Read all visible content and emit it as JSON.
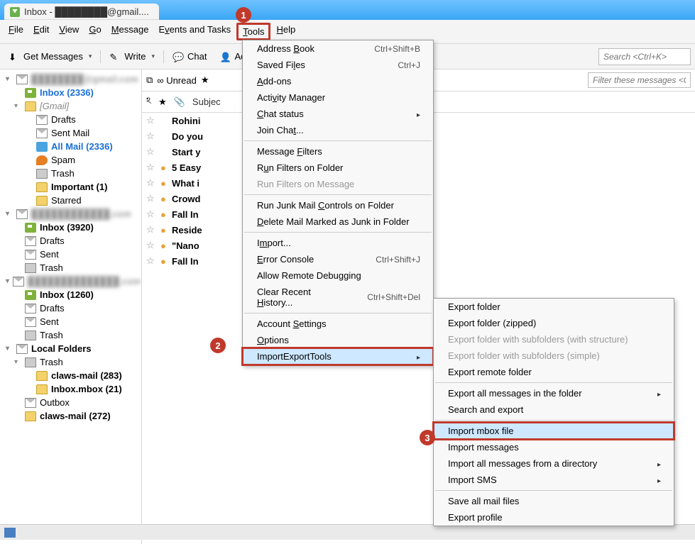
{
  "tab": {
    "title": "Inbox - ████████@gmail...."
  },
  "menubar": [
    "File",
    "Edit",
    "View",
    "Go",
    "Message",
    "Events and Tasks",
    "Tools",
    "Help"
  ],
  "callouts": {
    "1": "1",
    "2": "2",
    "3": "3"
  },
  "toolbar": {
    "getMessages": "Get Messages",
    "write": "Write",
    "chat": "Chat",
    "addressBook": "Ad",
    "search_placeholder": "Search <Ctrl+K>"
  },
  "filterbar": {
    "unread": "Unread",
    "filter_placeholder": "Filter these messages <Ctrl"
  },
  "msgheader": {
    "subject": "Subjec"
  },
  "sidebar": {
    "acct1": "████████@gmail.com",
    "acct1_items": [
      {
        "label": "Inbox (2336)",
        "icon": "ic-inbox",
        "sel": true,
        "bold": true
      },
      {
        "label": "[Gmail]",
        "icon": "ic-folder",
        "italic": true,
        "twisty": "▾"
      },
      {
        "label": "Drafts",
        "icon": "ic-mail",
        "l": 2
      },
      {
        "label": "Sent Mail",
        "icon": "ic-mail",
        "l": 2
      },
      {
        "label": "All Mail (2336)",
        "icon": "ic-allmail",
        "l": 2,
        "bold": true,
        "sel": true
      },
      {
        "label": "Spam",
        "icon": "ic-fire",
        "l": 2
      },
      {
        "label": "Trash",
        "icon": "ic-trash",
        "l": 2
      },
      {
        "label": "Important (1)",
        "icon": "ic-folder",
        "l": 2,
        "bold": true
      },
      {
        "label": "Starred",
        "icon": "ic-folder",
        "l": 2
      }
    ],
    "acct2": "████████████.com",
    "acct2_items": [
      {
        "label": "Inbox (3920)",
        "icon": "ic-inbox",
        "bold": true
      },
      {
        "label": "Drafts",
        "icon": "ic-mail"
      },
      {
        "label": "Sent",
        "icon": "ic-mail"
      },
      {
        "label": "Trash",
        "icon": "ic-trash"
      }
    ],
    "acct3": "██████████████.com",
    "acct3_items": [
      {
        "label": "Inbox (1260)",
        "icon": "ic-inbox",
        "bold": true
      },
      {
        "label": "Drafts",
        "icon": "ic-mail"
      },
      {
        "label": "Sent",
        "icon": "ic-mail"
      },
      {
        "label": "Trash",
        "icon": "ic-trash"
      }
    ],
    "local": "Local Folders",
    "local_items": [
      {
        "label": "Trash",
        "icon": "ic-trash",
        "twisty": "▾"
      },
      {
        "label": "claws-mail (283)",
        "icon": "ic-folder",
        "l": 2,
        "bold": true
      },
      {
        "label": "Inbox.mbox (21)",
        "icon": "ic-folder",
        "l": 2,
        "bold": true
      },
      {
        "label": "Outbox",
        "icon": "ic-mail"
      },
      {
        "label": "claws-mail (272)",
        "icon": "ic-folder",
        "bold": true
      }
    ]
  },
  "messages": [
    {
      "subject": "Rohini",
      "bold": true
    },
    {
      "subject": "Do you",
      "bold": true
    },
    {
      "subject": "Start y",
      "bold": true
    },
    {
      "subject": "5 Easy",
      "bold": true,
      "dot": true
    },
    {
      "subject": "What i",
      "bold": true,
      "dot": true
    },
    {
      "subject": "Crowd",
      "bold": true,
      "dot": true
    },
    {
      "subject": "Fall In",
      "bold": true,
      "dot": true
    },
    {
      "subject": "Reside",
      "bold": true,
      "dot": true
    },
    {
      "subject": "\"Nano",
      "bold": true,
      "dot": true
    },
    {
      "subject": "Fall In",
      "bold": true,
      "dot": true
    }
  ],
  "toolsMenu": [
    {
      "label": "Address Book",
      "u": "B",
      "shortcut": "Ctrl+Shift+B"
    },
    {
      "label": "Saved Files",
      "u": "l",
      "shortcut": "Ctrl+J"
    },
    {
      "label": "Add-ons",
      "u": "A"
    },
    {
      "label": "Activity Manager",
      "u": "v"
    },
    {
      "label": "Chat status",
      "u": "C",
      "arrow": true
    },
    {
      "label": "Join Chat...",
      "u": "t"
    },
    {
      "sep": true
    },
    {
      "label": "Message Filters",
      "u": "F"
    },
    {
      "label": "Run Filters on Folder",
      "u": "u"
    },
    {
      "label": "Run Filters on Message",
      "disabled": true
    },
    {
      "sep": true
    },
    {
      "label": "Run Junk Mail Controls on Folder",
      "u": "C"
    },
    {
      "label": "Delete Mail Marked as Junk in Folder",
      "u": "D"
    },
    {
      "sep": true
    },
    {
      "label": "Import...",
      "u": "m"
    },
    {
      "label": "Error Console",
      "u": "E",
      "shortcut": "Ctrl+Shift+J"
    },
    {
      "label": "Allow Remote Debugging",
      "u": "g"
    },
    {
      "label": "Clear Recent History...",
      "u": "H",
      "shortcut": "Ctrl+Shift+Del"
    },
    {
      "sep": true
    },
    {
      "label": "Account Settings",
      "u": "S"
    },
    {
      "label": "Options",
      "u": "O"
    },
    {
      "label": "ImportExportTools",
      "arrow": true,
      "highlight": true,
      "box": true
    }
  ],
  "submenu": [
    {
      "label": "Export folder"
    },
    {
      "label": "Export folder (zipped)"
    },
    {
      "label": "Export folder with subfolders (with structure)",
      "disabled": true
    },
    {
      "label": "Export folder with subfolders (simple)",
      "disabled": true
    },
    {
      "label": "Export remote folder"
    },
    {
      "sep": true
    },
    {
      "label": "Export all messages in the folder",
      "arrow": true
    },
    {
      "label": "Search and export"
    },
    {
      "sep": true
    },
    {
      "label": "Import mbox file",
      "highlight": true,
      "box": true
    },
    {
      "label": "Import messages"
    },
    {
      "label": "Import all messages from a directory",
      "arrow": true
    },
    {
      "label": "Import SMS",
      "arrow": true
    },
    {
      "sep": true
    },
    {
      "label": "Save all mail files"
    },
    {
      "label": "Export profile"
    }
  ]
}
